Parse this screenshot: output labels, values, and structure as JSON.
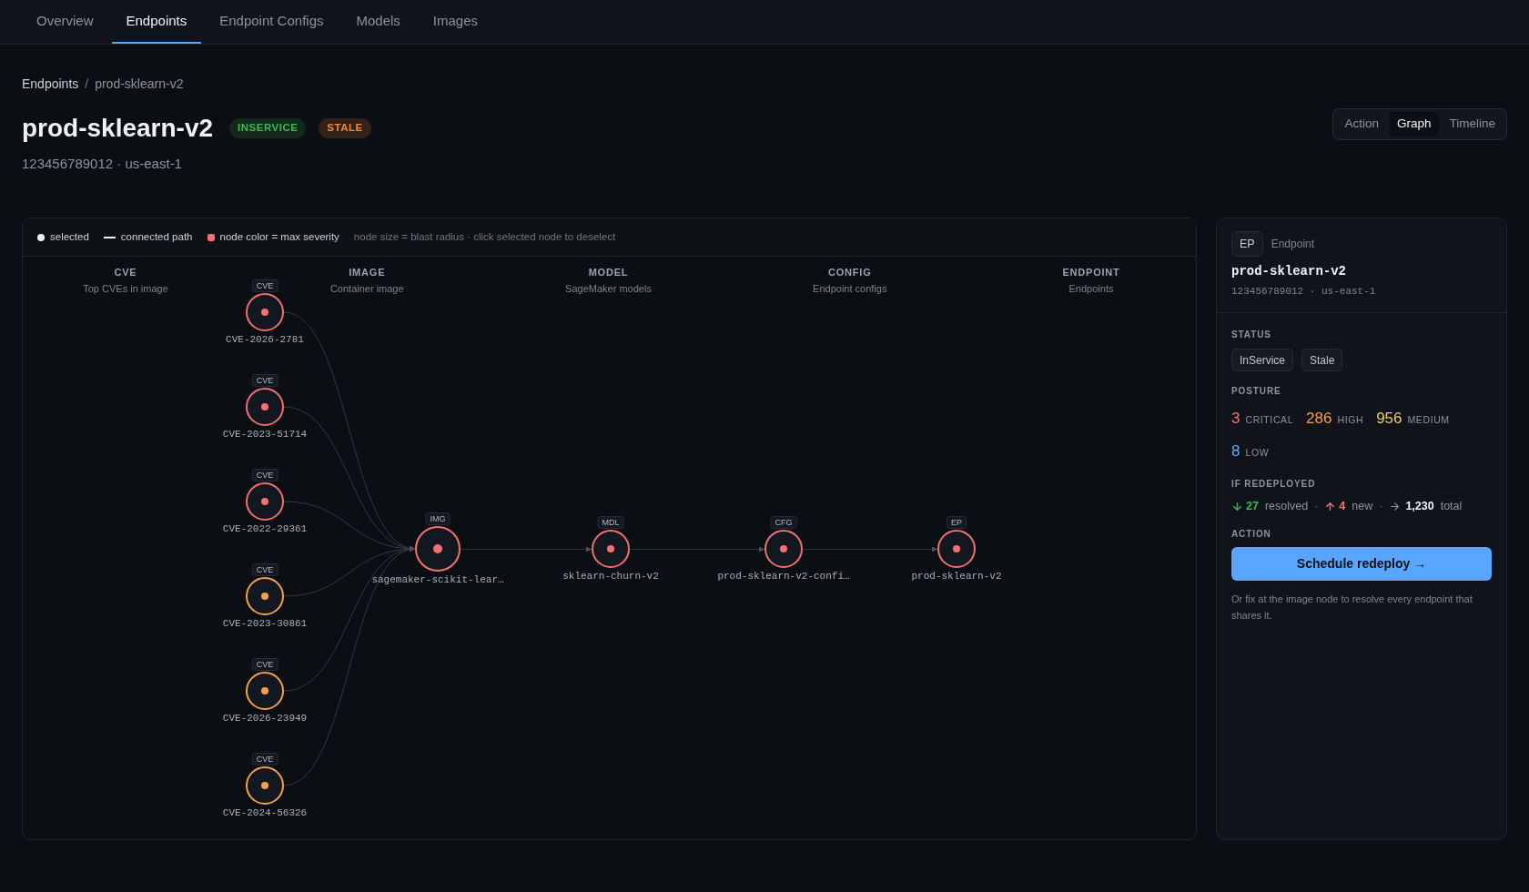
{
  "nav_tabs": [
    {
      "label": "Overview",
      "selected": false
    },
    {
      "label": "Endpoints",
      "selected": true
    },
    {
      "label": "Endpoint Configs",
      "selected": false
    },
    {
      "label": "Models",
      "selected": false
    },
    {
      "label": "Images",
      "selected": false
    }
  ],
  "breadcrumb": {
    "parent": "Endpoints",
    "separator": "/",
    "current": "prod-sklearn-v2"
  },
  "header": {
    "title": "prod-sklearn-v2",
    "badges": [
      {
        "label": "INSERVICE",
        "kind": "ok"
      },
      {
        "label": "STALE",
        "kind": "warn"
      }
    ],
    "subtitle": "123456789012 · us-east-1"
  },
  "view_toggle": [
    {
      "label": "Action",
      "selected": false
    },
    {
      "label": "Graph",
      "selected": true
    },
    {
      "label": "Timeline",
      "selected": false
    }
  ],
  "graph": {
    "legend": [
      {
        "kind": "dot",
        "label": "selected"
      },
      {
        "kind": "line",
        "label": "connected path"
      },
      {
        "kind": "swatch",
        "label": "node color = max severity"
      }
    ],
    "legend_note": "node size = blast radius · click selected node to deselect",
    "columns": [
      {
        "title": "CVE",
        "subtitle": "Top CVEs in image"
      },
      {
        "title": "IMAGE",
        "subtitle": "Container image"
      },
      {
        "title": "MODEL",
        "subtitle": "SageMaker models"
      },
      {
        "title": "CONFIG",
        "subtitle": "Endpoint configs"
      },
      {
        "title": "ENDPOINT",
        "subtitle": "Endpoints"
      }
    ],
    "cve_nodes": [
      {
        "tag": "CVE",
        "label": "CVE-2026-2781",
        "color": "#f47171"
      },
      {
        "tag": "CVE",
        "label": "CVE-2023-51714",
        "color": "#f47171"
      },
      {
        "tag": "CVE",
        "label": "CVE-2022-29361",
        "color": "#f47171"
      },
      {
        "tag": "CVE",
        "label": "CVE-2023-30861",
        "color": "#f5a04a"
      },
      {
        "tag": "CVE",
        "label": "CVE-2026-23949",
        "color": "#f5a04a"
      },
      {
        "tag": "CVE",
        "label": "CVE-2024-56326",
        "color": "#f5a04a"
      }
    ],
    "pipeline_nodes": [
      {
        "kind": "image",
        "tag": "IMG",
        "label": "sagemaker-scikit-lear…",
        "color": "#f47171"
      },
      {
        "kind": "model",
        "tag": "MDL",
        "label": "sklearn-churn-v2",
        "color": "#f47171"
      },
      {
        "kind": "config",
        "tag": "CFG",
        "label": "prod-sklearn-v2-confi…",
        "color": "#f47171"
      },
      {
        "kind": "endpoint",
        "tag": "EP",
        "label": "prod-sklearn-v2",
        "color": "#f47171"
      }
    ]
  },
  "detail": {
    "type_tag": "EP",
    "type_label": "Endpoint",
    "title": "prod-sklearn-v2",
    "subtitle": "123456789012 · us-east-1",
    "status_heading": "STATUS",
    "status_chips": [
      "InService",
      "Stale"
    ],
    "posture_heading": "POSTURE",
    "posture": [
      {
        "count": "3",
        "label": "CRITICAL",
        "color": "#f47171"
      },
      {
        "count": "286",
        "label": "HIGH",
        "color": "#f79d4c"
      },
      {
        "count": "956",
        "label": "MEDIUM",
        "color": "#f2cc60"
      },
      {
        "count": "8",
        "label": "LOW",
        "color": "#6ea8fe"
      }
    ],
    "redeploy_heading": "IF REDEPLOYED",
    "redeploy": {
      "resolved": {
        "count": "27",
        "label": "resolved"
      },
      "separator_1": "·",
      "new": {
        "count": "4",
        "label": "new"
      },
      "separator_2": "·",
      "total": {
        "count": "1,230",
        "label": "total"
      }
    },
    "action_heading": "ACTION",
    "action_button": "Schedule redeploy →",
    "note": "Or fix at the image node to resolve every endpoint that shares it."
  }
}
